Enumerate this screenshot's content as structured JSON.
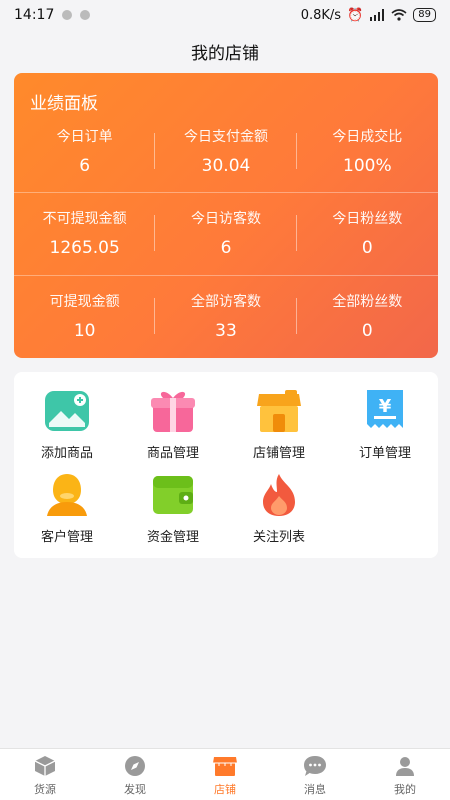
{
  "status_bar": {
    "time": "14:17",
    "network_speed": "0.8K/s",
    "battery": "89"
  },
  "nav": {
    "title": "我的店铺"
  },
  "performance": {
    "title": "业绩面板",
    "rows": [
      [
        {
          "label": "今日订单",
          "value": "6"
        },
        {
          "label": "今日支付金额",
          "value": "30.04"
        },
        {
          "label": "今日成交比",
          "value": "100%"
        }
      ],
      [
        {
          "label": "不可提现金额",
          "value": "1265.05"
        },
        {
          "label": "今日访客数",
          "value": "6"
        },
        {
          "label": "今日粉丝数",
          "value": "0"
        }
      ],
      [
        {
          "label": "可提现金额",
          "value": "10"
        },
        {
          "label": "全部访客数",
          "value": "33"
        },
        {
          "label": "全部粉丝数",
          "value": "0"
        }
      ]
    ]
  },
  "menu": {
    "items": [
      {
        "label": "添加商品",
        "icon": "add-image-icon"
      },
      {
        "label": "商品管理",
        "icon": "gift-icon"
      },
      {
        "label": "店铺管理",
        "icon": "store-icon"
      },
      {
        "label": "订单管理",
        "icon": "receipt-icon"
      },
      {
        "label": "客户管理",
        "icon": "customer-icon"
      },
      {
        "label": "资金管理",
        "icon": "wallet-icon"
      },
      {
        "label": "关注列表",
        "icon": "flame-icon"
      }
    ]
  },
  "tabs": [
    {
      "label": "货源",
      "icon": "box-icon",
      "active": false
    },
    {
      "label": "发现",
      "icon": "compass-icon",
      "active": false
    },
    {
      "label": "店铺",
      "icon": "shop-icon",
      "active": true
    },
    {
      "label": "消息",
      "icon": "chat-icon",
      "active": false
    },
    {
      "label": "我的",
      "icon": "user-icon",
      "active": false
    }
  ],
  "colors": {
    "accent": "#ff7a2b",
    "card_gradient_start": "#ff8a2b",
    "card_gradient_end": "#f2674a"
  }
}
